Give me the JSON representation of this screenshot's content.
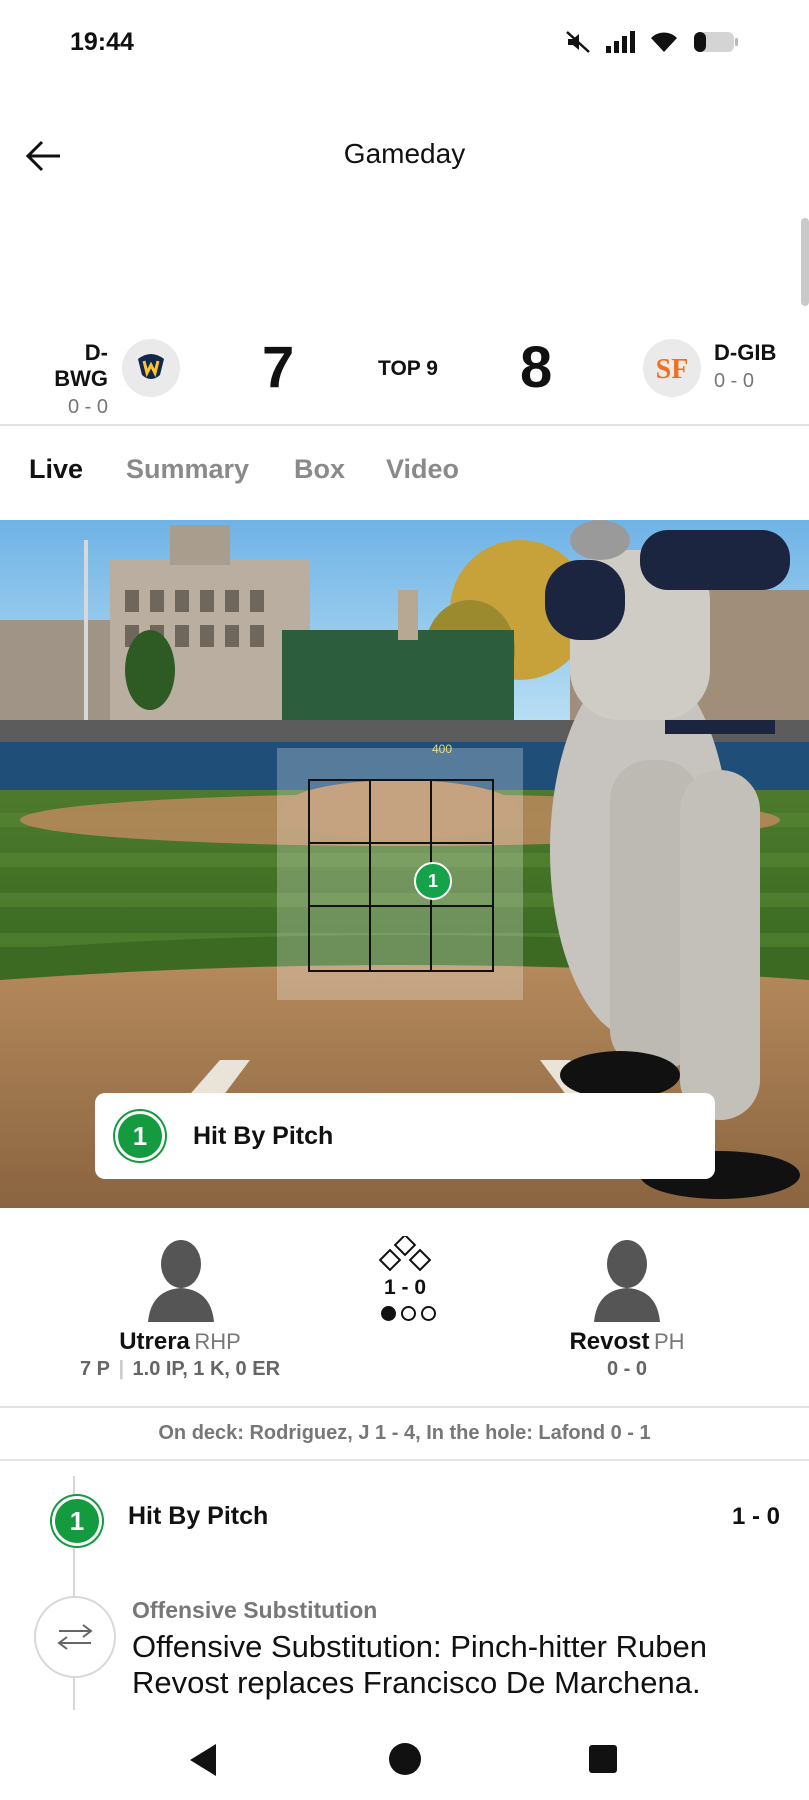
{
  "status_bar": {
    "time": "19:44"
  },
  "header": {
    "title": "Gameday"
  },
  "scoreboard": {
    "away": {
      "abbr": "D-BWG",
      "record": "0 - 0",
      "score": "7"
    },
    "home": {
      "abbr": "D-GIB",
      "record": "0 - 0",
      "score": "8"
    },
    "inning": "TOP 9"
  },
  "tabs": [
    {
      "label": "Live"
    },
    {
      "label": "Summary"
    },
    {
      "label": "Box"
    },
    {
      "label": "Video"
    }
  ],
  "field": {
    "distance_marker": "400",
    "pitch_number": "1",
    "event_card": {
      "number": "1",
      "text": "Hit By Pitch"
    }
  },
  "matchup": {
    "pitcher": {
      "name": "Utrera",
      "position": "RHP",
      "pitches": "7 P",
      "line": "1.0 IP, 1 K, 0 ER"
    },
    "count": "1 - 0",
    "batter": {
      "name": "Revost",
      "position": "PH",
      "line": "0 - 0"
    }
  },
  "on_deck": "On deck: Rodriguez, J 1 - 4, In the hole: Lafond 0 - 1",
  "plays": [
    {
      "number": "1",
      "title": "Hit By Pitch",
      "count": "1 - 0"
    },
    {
      "label": "Offensive Substitution",
      "description": "Offensive Substitution: Pinch-hitter Ruben Revost replaces Francisco De Marchena."
    }
  ],
  "colors": {
    "accent_green": "#149a3f",
    "giants_orange": "#f26f21"
  },
  "icons": [
    "back-arrow-icon",
    "mute-icon",
    "signal-icon",
    "wifi-icon",
    "battery-icon",
    "swap-icon"
  ]
}
